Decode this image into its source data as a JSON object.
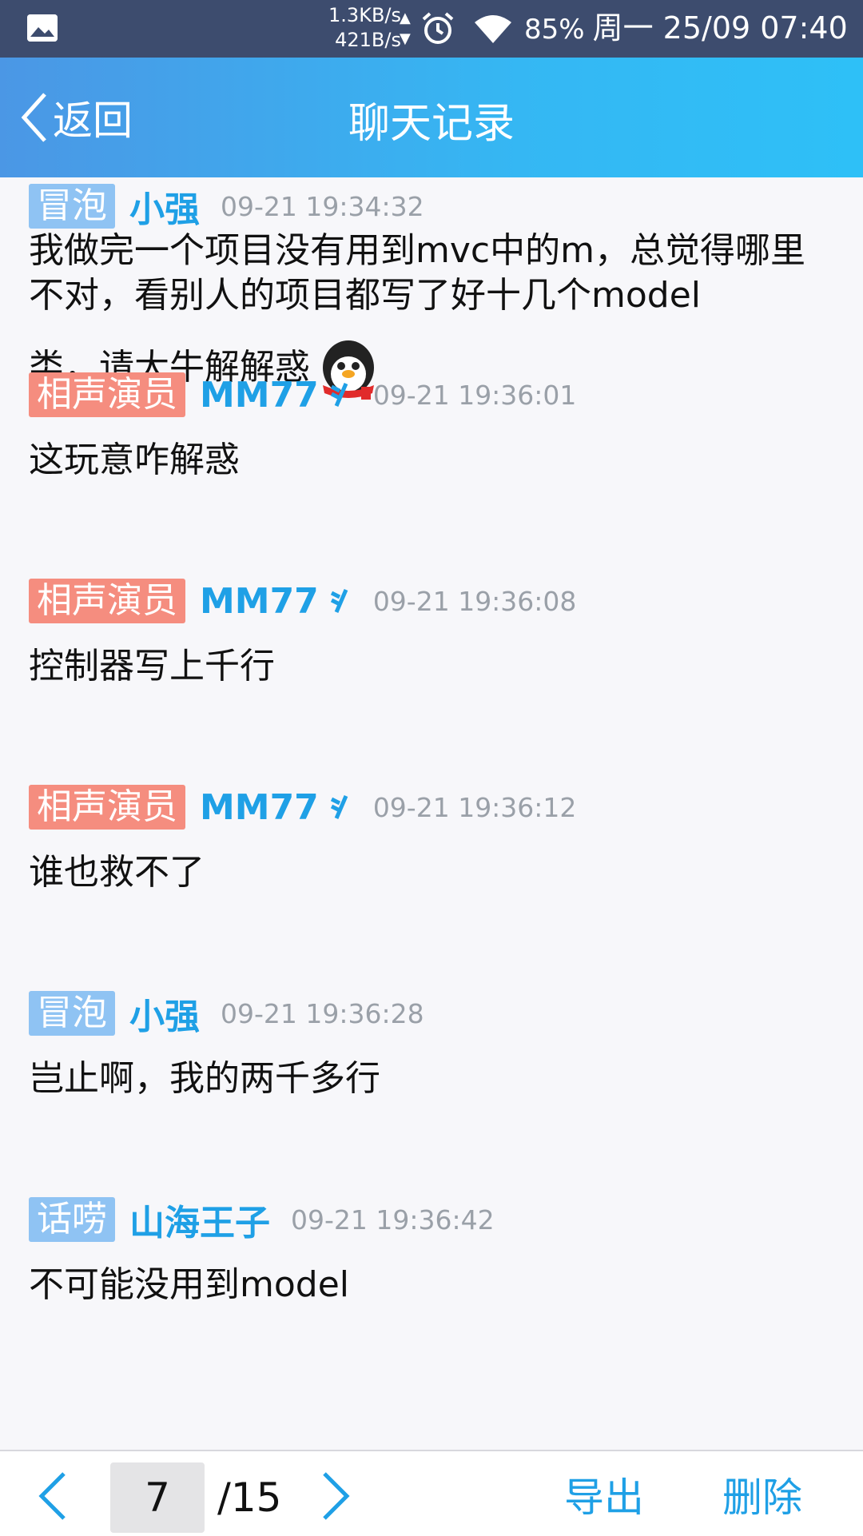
{
  "status": {
    "speed_up": "1.3KB/s",
    "speed_down": "421B/s",
    "battery": "85%",
    "datetime": "周一 25/09 07:40"
  },
  "header": {
    "back_label": "返回",
    "title": "聊天记录"
  },
  "messages": [
    {
      "badge": "冒泡",
      "sender": "小强",
      "time": "09-21 19:34:32",
      "text": "我做完一个项目没有用到mvc中的m，总觉得哪里不对，看别人的项目都写了好十几个model",
      "text2": "类，请大牛解解惑"
    },
    {
      "badge": "相声演员",
      "sender": "MM77",
      "time": "09-21 19:36:01",
      "text": "这玩意咋解惑"
    },
    {
      "badge": "相声演员",
      "sender": "MM77",
      "time": "09-21 19:36:08",
      "text": "控制器写上千行"
    },
    {
      "badge": "相声演员",
      "sender": "MM77",
      "time": "09-21 19:36:12",
      "text": "谁也救不了"
    },
    {
      "badge": "冒泡",
      "sender": "小强",
      "time": "09-21 19:36:28",
      "text": "岂止啊，我的两千多行"
    },
    {
      "badge": "话唠",
      "sender": "山海王子",
      "time": "09-21 19:36:42",
      "text": "不可能没用到model"
    }
  ],
  "footer": {
    "page": "7",
    "total": "/15",
    "export_label": "导出",
    "delete_label": "删除"
  },
  "colors": {
    "badge_blue": "#8fc3f3",
    "badge_red": "#f58d7f",
    "accent": "#1fa0e6"
  }
}
